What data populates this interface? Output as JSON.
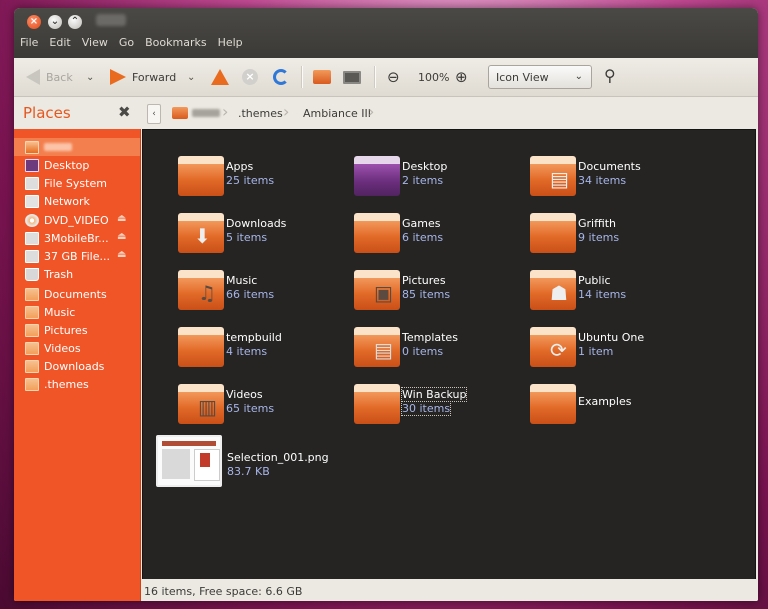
{
  "window": {
    "menu": [
      "File",
      "Edit",
      "View",
      "Go",
      "Bookmarks",
      "Help"
    ]
  },
  "toolbar": {
    "back_label": "Back",
    "forward_label": "Forward",
    "zoom_level": "100%",
    "view_mode": "Icon View"
  },
  "pathbar": {
    "places_label": "Places",
    "crumbs": [
      ".themes",
      "Ambiance III"
    ]
  },
  "sidebar": {
    "items": [
      {
        "label": "Desktop",
        "icon": "desktop-icon"
      },
      {
        "label": "File System",
        "icon": "filesystem-icon"
      },
      {
        "label": "Network",
        "icon": "network-icon"
      },
      {
        "label": "DVD_VIDEO",
        "icon": "disc-icon"
      },
      {
        "label": "3MobileBr...",
        "icon": "usb-drive-icon"
      },
      {
        "label": "37 GB File...",
        "icon": "drive-icon"
      },
      {
        "label": "Trash",
        "icon": "trash-icon"
      },
      {
        "label": "Documents",
        "icon": "folder-icon"
      },
      {
        "label": "Music",
        "icon": "folder-icon"
      },
      {
        "label": "Pictures",
        "icon": "folder-icon"
      },
      {
        "label": "Videos",
        "icon": "folder-icon"
      },
      {
        "label": "Downloads",
        "icon": "folder-icon"
      },
      {
        "label": ".themes",
        "icon": "folder-icon"
      }
    ]
  },
  "files": [
    {
      "name": "Apps",
      "info": "25 items"
    },
    {
      "name": "Desktop",
      "info": "2 items"
    },
    {
      "name": "Documents",
      "info": "34 items"
    },
    {
      "name": "Downloads",
      "info": "5 items"
    },
    {
      "name": "Games",
      "info": "6 items"
    },
    {
      "name": "Griffith",
      "info": "9 items"
    },
    {
      "name": "Music",
      "info": "66 items"
    },
    {
      "name": "Pictures",
      "info": "85 items"
    },
    {
      "name": "Public",
      "info": "14 items"
    },
    {
      "name": "tempbuild",
      "info": "4 items"
    },
    {
      "name": "Templates",
      "info": "0 items"
    },
    {
      "name": "Ubuntu One",
      "info": "1 item"
    },
    {
      "name": "Videos",
      "info": "65 items"
    },
    {
      "name": "Win Backup",
      "info": "30 items"
    },
    {
      "name": "Examples",
      "info": ""
    },
    {
      "name": "Selection_001.png",
      "info": "83.7 KB"
    }
  ],
  "status": {
    "text": "16 items, Free space: 6.6 GB"
  },
  "colors": {
    "accent": "#ef5527",
    "icon_view_bg": "#252423",
    "item_info": "#a7b6e8"
  }
}
